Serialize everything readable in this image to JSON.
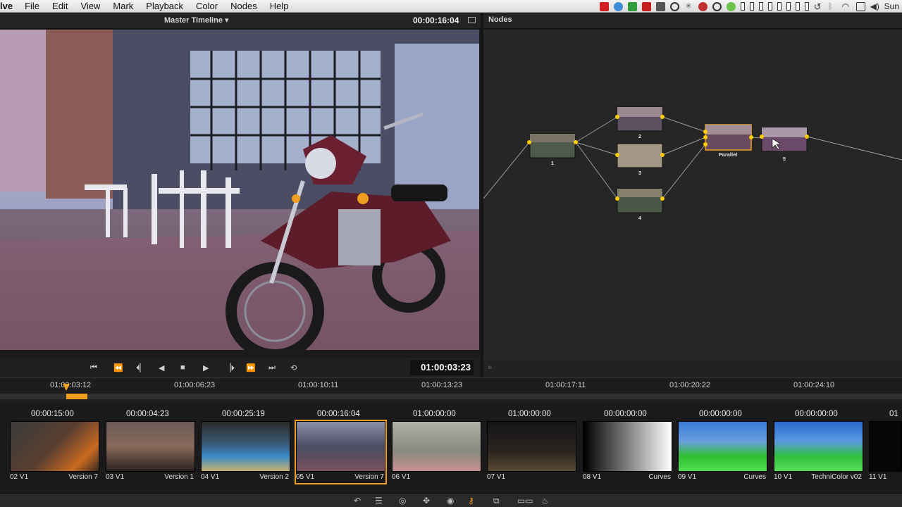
{
  "menubar": {
    "app": "lve",
    "items": [
      "File",
      "Edit",
      "View",
      "Mark",
      "Playback",
      "Color",
      "Nodes",
      "Help"
    ],
    "clock": "Sun"
  },
  "viewer": {
    "title": "Master Timeline ▾",
    "timecode": "00:00:16:04",
    "transport_timecode": "01:00:03:23"
  },
  "nodes": {
    "title": "Nodes",
    "labels": [
      "1",
      "2",
      "3",
      "4",
      "Parallel",
      "5"
    ]
  },
  "ruler": {
    "labels": [
      "01:00:03:12",
      "01:00:06:23",
      "01:00:10:11",
      "01:00:13:23",
      "01:00:17:11",
      "01:00:20:22",
      "01:00:24:10"
    ]
  },
  "clips": [
    {
      "tc": "00:00:15:00",
      "left": "02 V1",
      "right": "Version 7"
    },
    {
      "tc": "00:00:04:23",
      "left": "03 V1",
      "right": "Version 1"
    },
    {
      "tc": "00:00:25:19",
      "left": "04 V1",
      "right": "Version 2"
    },
    {
      "tc": "00:00:16:04",
      "left": "05 V1",
      "right": "Version 7"
    },
    {
      "tc": "01:00:00:00",
      "left": "06 V1",
      "right": ""
    },
    {
      "tc": "01:00:00:00",
      "left": "07 V1",
      "right": ""
    },
    {
      "tc": "00:00:00:00",
      "left": "08 V1",
      "right": "Curves"
    },
    {
      "tc": "00:00:00:00",
      "left": "09 V1",
      "right": "Curves"
    },
    {
      "tc": "00:00:00:00",
      "left": "10 V1",
      "right": "TechniColor v02"
    },
    {
      "tc": "01",
      "left": "11 V1",
      "right": ""
    }
  ],
  "colors": {
    "accent": "#f0a020",
    "selected_clip": "#f0a020",
    "node_connector": "#ffcc00"
  }
}
